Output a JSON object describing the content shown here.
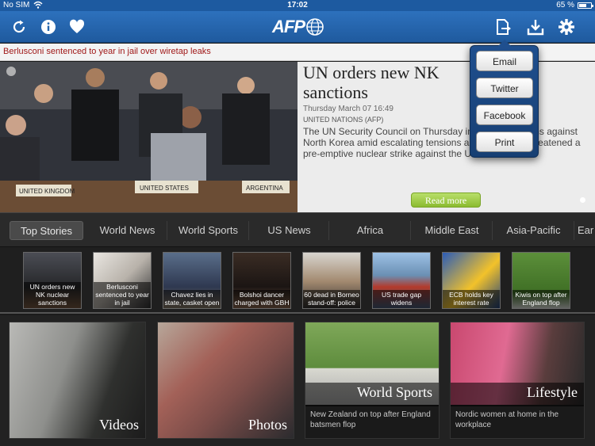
{
  "status": {
    "carrier": "No SIM",
    "time": "17:02",
    "battery_text": "65 %",
    "battery_level": 0.65
  },
  "ticker": {
    "headline": "Berlusconi sentenced to year in jail over wiretap leaks"
  },
  "hero": {
    "title": "UN orders new NK sanctions",
    "date": "Thursday March 07 16:49",
    "source": "UNITED NATIONS (AFP)",
    "body": "The UN Security Council on Thursday imposed sanctions against North Korea amid escalating tensions as Pyongyang threatened a pre-emptive nuclear strike against the US.",
    "read_more": "Read more",
    "photo_caption_signs": [
      "UNITED KINGDOM",
      "UNITED STATES",
      "ARGENTINA"
    ]
  },
  "share_menu": {
    "items": [
      "Email",
      "Twitter",
      "Facebook",
      "Print"
    ]
  },
  "tabs": [
    "Top Stories",
    "World News",
    "World Sports",
    "US News",
    "Africa",
    "Middle East",
    "Asia-Pacific",
    "Ear"
  ],
  "active_tab": "Top Stories",
  "thumbs": [
    {
      "caption": "UN orders new NK nuclear sanctions"
    },
    {
      "caption": "Berlusconi sentenced to year in jail"
    },
    {
      "caption": "Chavez lies in state, casket open"
    },
    {
      "caption": "Bolshoi dancer charged with GBH"
    },
    {
      "caption": "60 dead in Borneo stand-off: police"
    },
    {
      "caption": "US trade gap widens"
    },
    {
      "caption": "ECB holds key interest rate"
    },
    {
      "caption": "Kiwis on top after England flop"
    }
  ],
  "tiles": {
    "videos": {
      "label": "Videos"
    },
    "photos": {
      "label": "Photos"
    },
    "sports": {
      "label": "World Sports",
      "sub": "New Zealand on top after England batsmen flop"
    },
    "lifestyle": {
      "label": "Lifestyle",
      "sub": "Nordic women at home in the workplace"
    }
  },
  "logo_text": "AFP",
  "colors": {
    "toolbar": "#2565ad",
    "ticker_text": "#a01818",
    "read_more": "#9ccb3e"
  }
}
